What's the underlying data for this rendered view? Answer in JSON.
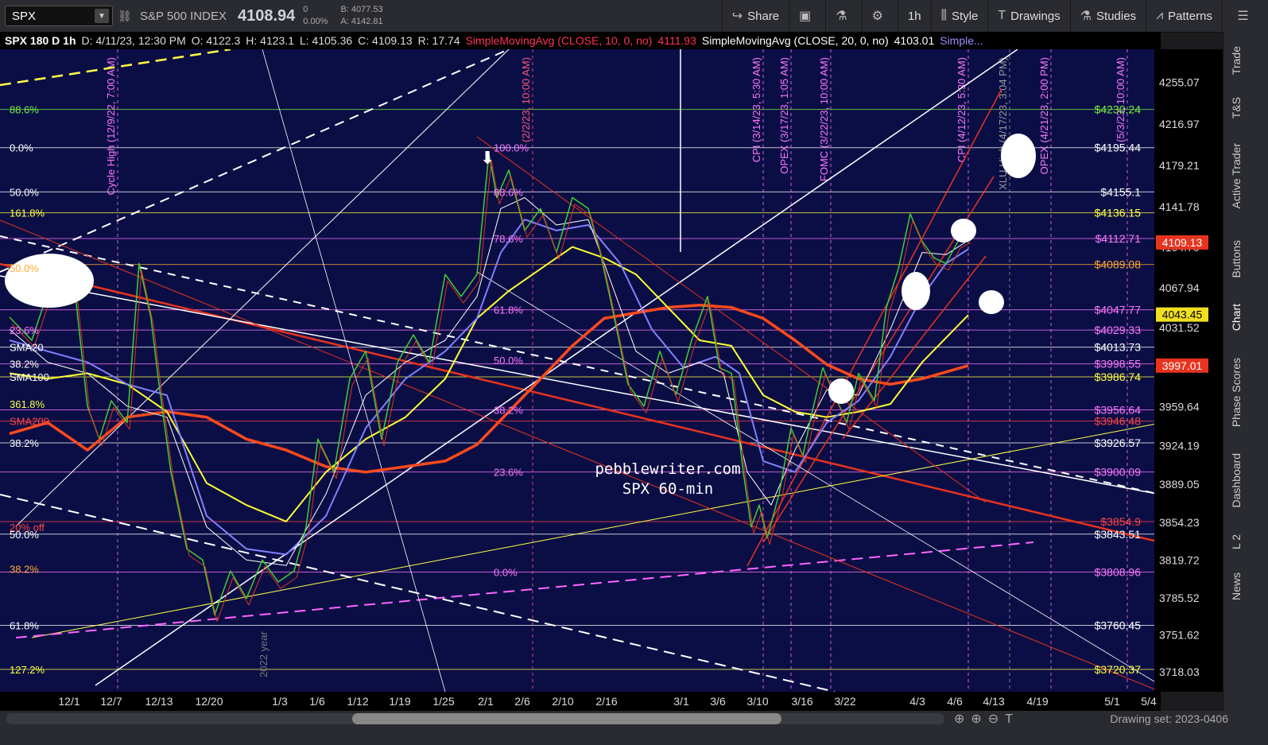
{
  "toolbar": {
    "symbol": "SPX",
    "index_name": "S&P 500 INDEX",
    "last_price": "4108.94",
    "change": "0",
    "change_pct": "0.00%",
    "bid": "B: 4077.53",
    "ask": "A: 4142.81",
    "buttons": {
      "share": "Share",
      "interval": "1h",
      "style": "Style",
      "drawings": "Drawings",
      "studies": "Studies",
      "patterns": "Patterns"
    }
  },
  "status": {
    "title": "SPX 180 D 1h",
    "date": "D: 4/11/23, 12:30 PM",
    "open": "O: 4122.3",
    "high": "H: 4123.1",
    "low": "L: 4105.36",
    "close": "C: 4109.13",
    "range": "R: 17.74",
    "sma10": "SimpleMovingAvg (CLOSE, 10, 0, no)",
    "sma10_val": "4111.93",
    "sma20": "SimpleMovingAvg (CLOSE, 20, 0, no)",
    "sma20_val": "4103.01",
    "more": "Simple..."
  },
  "chart_data": {
    "type": "line",
    "title": "",
    "watermark": [
      "pebblewriter.com",
      "SPX 60-min"
    ],
    "ylim": [
      3700,
      4285
    ],
    "y_ticks": [
      4255.07,
      4216.97,
      4179.21,
      4141.78,
      4104.7,
      4067.94,
      4031.52,
      3995.44,
      3959.64,
      3924.19,
      3889.05,
      3854.23,
      3819.72,
      3785.52,
      3751.62,
      3718.03
    ],
    "x_ticks": [
      "12/1",
      "12/7",
      "12/13",
      "12/20",
      "1/3",
      "1/6",
      "1/12",
      "1/19",
      "1/25",
      "2/1",
      "2/6",
      "2/10",
      "2/16",
      "3/1",
      "3/6",
      "3/10",
      "3/16",
      "3/22",
      "4/3",
      "4/6",
      "4/13",
      "4/19",
      "5/1",
      "5/4"
    ],
    "x_tick_pos": [
      87,
      140,
      200,
      263,
      352,
      399,
      450,
      503,
      558,
      611,
      657,
      708,
      763,
      857,
      903,
      953,
      1009,
      1063,
      1154,
      1201,
      1250,
      1305,
      1399,
      1445
    ],
    "price_series": [
      [
        12,
        4041
      ],
      [
        40,
        4020
      ],
      [
        70,
        4085
      ],
      [
        95,
        4060
      ],
      [
        110,
        3960
      ],
      [
        125,
        3930
      ],
      [
        140,
        3965
      ],
      [
        160,
        3945
      ],
      [
        175,
        4090
      ],
      [
        190,
        4040
      ],
      [
        200,
        3980
      ],
      [
        215,
        3900
      ],
      [
        235,
        3830
      ],
      [
        255,
        3820
      ],
      [
        270,
        3770
      ],
      [
        290,
        3810
      ],
      [
        310,
        3785
      ],
      [
        330,
        3820
      ],
      [
        350,
        3800
      ],
      [
        370,
        3810
      ],
      [
        385,
        3850
      ],
      [
        400,
        3930
      ],
      [
        420,
        3900
      ],
      [
        440,
        3985
      ],
      [
        460,
        4010
      ],
      [
        480,
        3930
      ],
      [
        500,
        4000
      ],
      [
        520,
        4025
      ],
      [
        540,
        4000
      ],
      [
        560,
        4080
      ],
      [
        580,
        4060
      ],
      [
        600,
        4080
      ],
      [
        615,
        4190
      ],
      [
        625,
        4150
      ],
      [
        640,
        4175
      ],
      [
        660,
        4120
      ],
      [
        680,
        4140
      ],
      [
        700,
        4100
      ],
      [
        720,
        4150
      ],
      [
        740,
        4140
      ],
      [
        755,
        4100
      ],
      [
        770,
        4050
      ],
      [
        790,
        3980
      ],
      [
        810,
        3960
      ],
      [
        830,
        4010
      ],
      [
        850,
        3970
      ],
      [
        870,
        4020
      ],
      [
        890,
        4060
      ],
      [
        905,
        3995
      ],
      [
        920,
        3990
      ],
      [
        935,
        3900
      ],
      [
        945,
        3850
      ],
      [
        955,
        3870
      ],
      [
        965,
        3840
      ],
      [
        980,
        3880
      ],
      [
        995,
        3940
      ],
      [
        1010,
        3915
      ],
      [
        1020,
        3950
      ],
      [
        1035,
        3995
      ],
      [
        1050,
        3970
      ],
      [
        1065,
        3945
      ],
      [
        1080,
        3990
      ],
      [
        1100,
        3965
      ],
      [
        1115,
        4050
      ],
      [
        1130,
        4085
      ],
      [
        1145,
        4135
      ],
      [
        1160,
        4110
      ],
      [
        1175,
        4095
      ],
      [
        1190,
        4090
      ],
      [
        1205,
        4110
      ],
      [
        1218,
        4115
      ]
    ],
    "sma10": [
      [
        12,
        4030
      ],
      [
        60,
        4000
      ],
      [
        110,
        3990
      ],
      [
        160,
        3960
      ],
      [
        210,
        3950
      ],
      [
        260,
        3850
      ],
      [
        310,
        3820
      ],
      [
        360,
        3815
      ],
      [
        410,
        3880
      ],
      [
        460,
        3970
      ],
      [
        510,
        4000
      ],
      [
        560,
        4020
      ],
      [
        600,
        4060
      ],
      [
        630,
        4140
      ],
      [
        660,
        4150
      ],
      [
        700,
        4125
      ],
      [
        740,
        4130
      ],
      [
        760,
        4090
      ],
      [
        800,
        4010
      ],
      [
        840,
        3990
      ],
      [
        880,
        4000
      ],
      [
        910,
        3990
      ],
      [
        940,
        3900
      ],
      [
        970,
        3870
      ],
      [
        1000,
        3920
      ],
      [
        1040,
        3975
      ],
      [
        1080,
        3970
      ],
      [
        1120,
        4030
      ],
      [
        1160,
        4100
      ],
      [
        1190,
        4098
      ],
      [
        1218,
        4111
      ]
    ],
    "sma20": [
      [
        12,
        4020
      ],
      [
        60,
        4010
      ],
      [
        110,
        4000
      ],
      [
        160,
        3980
      ],
      [
        210,
        3970
      ],
      [
        260,
        3860
      ],
      [
        310,
        3830
      ],
      [
        360,
        3825
      ],
      [
        410,
        3860
      ],
      [
        460,
        3940
      ],
      [
        510,
        3985
      ],
      [
        560,
        4010
      ],
      [
        600,
        4040
      ],
      [
        630,
        4100
      ],
      [
        660,
        4130
      ],
      [
        700,
        4120
      ],
      [
        740,
        4125
      ],
      [
        780,
        4090
      ],
      [
        820,
        4030
      ],
      [
        860,
        3995
      ],
      [
        900,
        4005
      ],
      [
        930,
        3990
      ],
      [
        960,
        3910
      ],
      [
        1000,
        3900
      ],
      [
        1040,
        3945
      ],
      [
        1080,
        3965
      ],
      [
        1120,
        4005
      ],
      [
        1160,
        4060
      ],
      [
        1190,
        4090
      ],
      [
        1218,
        4103
      ]
    ],
    "sma50": [
      [
        12,
        3990
      ],
      [
        60,
        3985
      ],
      [
        110,
        3990
      ],
      [
        160,
        3980
      ],
      [
        210,
        3955
      ],
      [
        260,
        3890
      ],
      [
        310,
        3870
      ],
      [
        360,
        3855
      ],
      [
        410,
        3900
      ],
      [
        460,
        3930
      ],
      [
        510,
        3950
      ],
      [
        560,
        3985
      ],
      [
        600,
        4040
      ],
      [
        640,
        4065
      ],
      [
        680,
        4085
      ],
      [
        720,
        4105
      ],
      [
        760,
        4095
      ],
      [
        800,
        4080
      ],
      [
        840,
        4050
      ],
      [
        880,
        4020
      ],
      [
        920,
        4015
      ],
      [
        960,
        3970
      ],
      [
        1000,
        3955
      ],
      [
        1040,
        3950
      ],
      [
        1080,
        3955
      ],
      [
        1120,
        3962
      ],
      [
        1160,
        4000
      ],
      [
        1218,
        4043
      ]
    ],
    "sma100": [
      [
        12,
        3935
      ],
      [
        60,
        3945
      ],
      [
        110,
        3920
      ],
      [
        160,
        3950
      ],
      [
        210,
        3955
      ],
      [
        260,
        3950
      ],
      [
        310,
        3930
      ],
      [
        360,
        3920
      ],
      [
        410,
        3905
      ],
      [
        460,
        3900
      ],
      [
        510,
        3905
      ],
      [
        560,
        3910
      ],
      [
        600,
        3925
      ],
      [
        640,
        3955
      ],
      [
        680,
        3985
      ],
      [
        720,
        4015
      ],
      [
        760,
        4040
      ],
      [
        800,
        4045
      ],
      [
        840,
        4050
      ],
      [
        880,
        4052
      ],
      [
        920,
        4050
      ],
      [
        960,
        4040
      ],
      [
        1000,
        4020
      ],
      [
        1040,
        3998
      ],
      [
        1080,
        3985
      ],
      [
        1120,
        3980
      ],
      [
        1160,
        3985
      ],
      [
        1218,
        3997
      ]
    ],
    "h_levels": [
      {
        "y": 4230.24,
        "label": "$4230.24",
        "color": "#77ee44"
      },
      {
        "y": 4195.44,
        "label": "$4195.44",
        "color": "#ffffff"
      },
      {
        "y": 4155.1,
        "label": "$4155.1",
        "color": "#ffffff"
      },
      {
        "y": 4136.15,
        "label": "$4136.15",
        "color": "#ffff44"
      },
      {
        "y": 4112.71,
        "label": "$4112.71",
        "color": "#ff77ff"
      },
      {
        "y": 4089.08,
        "label": "$4089.08",
        "color": "#ffaa33"
      },
      {
        "y": 4047.77,
        "label": "$4047.77",
        "color": "#ff77ff"
      },
      {
        "y": 4029.33,
        "label": "$4029.33",
        "color": "#ff77ff"
      },
      {
        "y": 4013.73,
        "label": "$4013.73",
        "color": "#ffffff"
      },
      {
        "y": 3998.55,
        "label": "$3998.55",
        "color": "#ff77ff"
      },
      {
        "y": 3986.74,
        "label": "$3986.74",
        "color": "#ffff44"
      },
      {
        "y": 3956.64,
        "label": "$3956.64",
        "color": "#ff77ff"
      },
      {
        "y": 3946.48,
        "label": "$3946.48",
        "color": "#ff4444"
      },
      {
        "y": 3926.57,
        "label": "$3926.57",
        "color": "#ffffff"
      },
      {
        "y": 3900.09,
        "label": "$3900.09",
        "color": "#ff77ff"
      },
      {
        "y": 3854.9,
        "label": "$3854.9",
        "color": "#ff4444"
      },
      {
        "y": 3843.51,
        "label": "$3843.51",
        "color": "#ffffff"
      },
      {
        "y": 3808.96,
        "label": "$3808.96",
        "color": "#ff77ff"
      },
      {
        "y": 3760.45,
        "label": "$3760.45",
        "color": "#ffffff"
      },
      {
        "y": 3720.37,
        "label": "$3720.37",
        "color": "#ffff44"
      }
    ],
    "left_labels": [
      {
        "y": 4230.24,
        "text": "88.6%",
        "color": "#77ee44"
      },
      {
        "y": 4195.44,
        "text": "0.0%",
        "color": "#ffffff"
      },
      {
        "y": 4155.1,
        "text": "50.0%",
        "color": "#ffffff"
      },
      {
        "y": 4136.15,
        "text": "161.8%",
        "color": "#ffff44"
      },
      {
        "y": 4086,
        "text": "50.0%",
        "color": "#ffaa33"
      },
      {
        "y": 4029.33,
        "text": "23.6%",
        "color": "#ff77ff"
      },
      {
        "y": 4013.73,
        "text": "SMA20",
        "color": "#ffffff"
      },
      {
        "y": 3998.55,
        "text": "38.2%",
        "color": "#ffffff"
      },
      {
        "y": 3986.74,
        "text": "SMA100",
        "color": "#ffffff"
      },
      {
        "y": 3962,
        "text": "361.8%",
        "color": "#ffff44"
      },
      {
        "y": 3946.48,
        "text": "SMA200",
        "color": "#ff4444"
      },
      {
        "y": 3926.57,
        "text": "38.2%",
        "color": "#ffffff"
      },
      {
        "y": 3850,
        "text": "20% off",
        "color": "#ff4444"
      },
      {
        "y": 3843.51,
        "text": "50.0%",
        "color": "#ffffff"
      },
      {
        "y": 3812,
        "text": "38.2%",
        "color": "#ffaa33"
      },
      {
        "y": 3760.45,
        "text": "61.8%",
        "color": "#ffffff"
      },
      {
        "y": 3720.37,
        "text": "127.2%",
        "color": "#ffff44"
      }
    ],
    "fib_labels": [
      {
        "y": 4195.44,
        "text": "100.0%"
      },
      {
        "y": 4155.1,
        "text": "88.6%"
      },
      {
        "y": 4112.71,
        "text": "78.6%"
      },
      {
        "y": 4047.77,
        "text": "61.8%"
      },
      {
        "y": 4002,
        "text": "50.0%"
      },
      {
        "y": 3956.64,
        "text": "38.2%"
      },
      {
        "y": 3900.09,
        "text": "23.6%"
      },
      {
        "y": 3808.96,
        "text": "0.0%"
      }
    ],
    "events": [
      {
        "x": 148,
        "text": "Cycle High (12/9/22, 7:00 AM)",
        "color": "#ff77ff"
      },
      {
        "x": 670,
        "text": "(2/2/23, 10:00 AM)",
        "color": "#ff5577"
      },
      {
        "x": 960,
        "text": "CPI (3/14/23, 5:30 AM)",
        "color": "#ff77ff"
      },
      {
        "x": 995,
        "text": "OPEX (3/17/23, 1:05 AM)",
        "color": "#ff77ff"
      },
      {
        "x": 1045,
        "text": "FOMC (3/22/23, 10:00 AM)",
        "color": "#ff77ff"
      },
      {
        "x": 1218,
        "text": "CPI (4/12/23, 5:30 AM)",
        "color": "#ff77ff"
      },
      {
        "x": 1270,
        "text": "XLU High (4/17/23, 3:04 PM)",
        "color": "#999999"
      },
      {
        "x": 1322,
        "text": "OPEX (4/21/23, 2:00 PM)",
        "color": "#ff77ff"
      },
      {
        "x": 1418,
        "text": "(5/3/23, 10:00 AM)",
        "color": "#ff77ff"
      }
    ],
    "price_tags": [
      {
        "y": 4109.13,
        "text": "4109.13",
        "bg": "#e8331e",
        "fg": "#ffffff"
      },
      {
        "y": 4043.45,
        "text": "4043.45",
        "bg": "#f0e020",
        "fg": "#000000"
      },
      {
        "y": 3997.01,
        "text": "3997.01",
        "bg": "#e8331e",
        "fg": "#ffffff"
      }
    ],
    "year_label": "2022 year",
    "grid": false
  },
  "sidebar": [
    "Trade",
    "T&S",
    "Active Trader",
    "Buttons",
    "Chart",
    "Phase Scores",
    "Dashboard",
    "L 2",
    "News"
  ],
  "bottom": {
    "drawing_set": "Drawing set: 2023-0406"
  }
}
